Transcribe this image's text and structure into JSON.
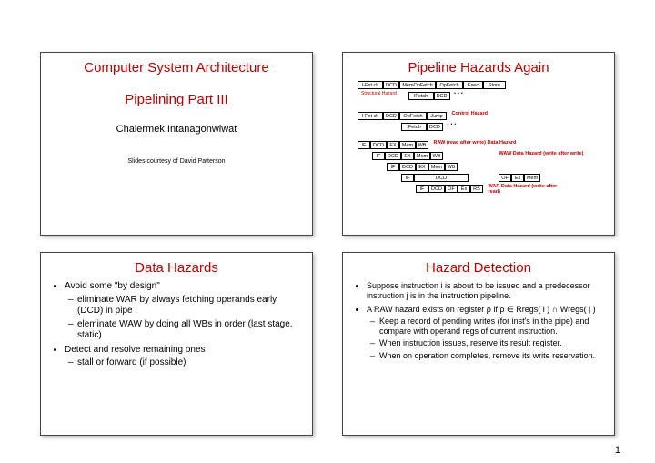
{
  "pageNumber": "1",
  "slides": {
    "topLeft": {
      "title1": "Computer System Architecture",
      "title2": "Pipelining Part III",
      "author": "Chalermek Intanagonwiwat",
      "credits": "Slides courtesy of David Patterson"
    },
    "topRight": {
      "title": "Pipeline Hazards Again",
      "rows": {
        "r1": [
          "I-Fet ch",
          "DCD",
          "MemOpFetch",
          "OpFetch",
          "Exec",
          "Store"
        ],
        "r2_boxes": [
          "IFetch",
          "DCD"
        ],
        "r2_label": "Structural Hazard",
        "r3": [
          "I-Fet ch",
          "DCD",
          "OpFetch",
          "Jump"
        ],
        "r3_label": "Control Hazard",
        "r4": [
          "IFetch",
          "DCD"
        ],
        "r5": [
          "IF",
          "DCD",
          "EX",
          "Mem",
          "WB"
        ],
        "r5_label": "RAW (read after write) Data Hazard",
        "r6": [
          "IF",
          "DCD",
          "EX",
          "Mem",
          "WB"
        ],
        "r6_label": "WAW Data Hazard (write after write)",
        "r7": [
          "IF",
          "DCD",
          "EX",
          "Mem",
          "WB"
        ],
        "r8": [
          "IF",
          "DCD"
        ],
        "r8b": [
          "OF",
          "Ex",
          "Mem"
        ],
        "r9": [
          "IF",
          "DCD",
          "OF",
          "Ex",
          "RS"
        ],
        "r9_label": "WAR Data Hazard (write after read)"
      }
    },
    "bottomLeft": {
      "title": "Data Hazards",
      "items": [
        {
          "t": "Avoid some \"by design\"",
          "sub": [
            "eliminate WAR by always fetching operands early (DCD) in pipe",
            "eleminate WAW by doing all WBs in order (last stage, static)"
          ]
        },
        {
          "t": "Detect and resolve remaining ones",
          "sub": [
            "stall or forward (if possible)"
          ]
        }
      ]
    },
    "bottomRight": {
      "title": "Hazard Detection",
      "items": [
        {
          "t": "Suppose instruction i  is about to be issued and a predecessor instruction j  is in the instruction pipeline."
        },
        {
          "t": "A RAW hazard exists on register ρ if ρ ∈ Rregs( i ) ∩ Wregs( j )",
          "sub": [
            "Keep a record of pending writes (for inst's in the pipe) and compare with operand regs of current instruction.",
            "When instruction issues, reserve its result register.",
            "When on operation completes, remove its write reservation."
          ]
        }
      ]
    }
  }
}
